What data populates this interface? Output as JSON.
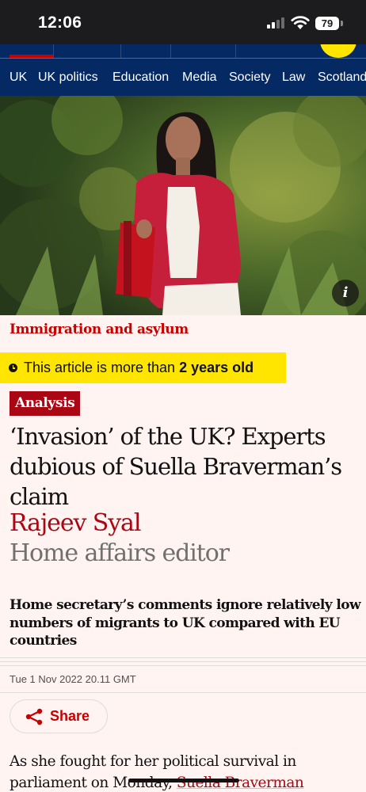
{
  "status_bar": {
    "time": "12:06",
    "battery": "79"
  },
  "subnav": [
    "UK",
    "UK politics",
    "Education",
    "Media",
    "Society",
    "Law",
    "Scotland"
  ],
  "hero": {
    "info_button": "i"
  },
  "article": {
    "section": "Immigration and asylum",
    "age_warning_prefix": "This article is more than ",
    "age_warning_emphasis": "2 years old",
    "badge": "Analysis",
    "headline": "‘Invasion’ of the UK? Experts dubious of Suella Braverman’s claim",
    "author": "Rajeev Syal",
    "author_role": "Home affairs editor",
    "standfirst": "Home secretary’s comments ignore relatively low numbers of migrants to UK compared with EU countries",
    "date": "Tue 1 Nov 2022 20.11 GMT",
    "share_label": "Share",
    "body_start": "As she fought for her political survival in parliament on Monday, ",
    "body_link": "Suella Braverman"
  },
  "colors": {
    "masthead": "#052962",
    "news_red": "#c70000",
    "badge_red": "#ab0613",
    "warning_yellow": "#ffe500",
    "page_background": "#fff4f2"
  }
}
